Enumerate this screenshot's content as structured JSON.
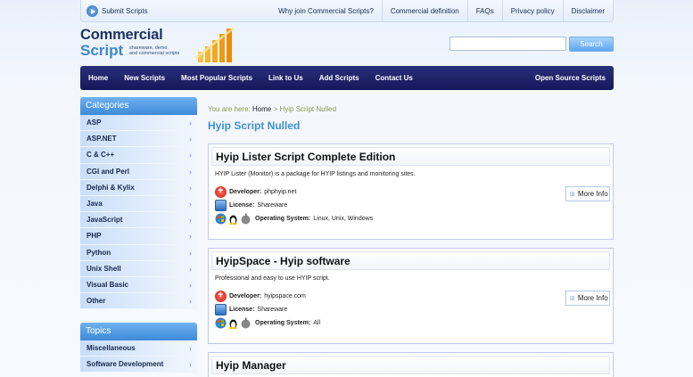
{
  "topbar": {
    "submit_label": "Submit Scripts",
    "links": [
      "Why join Commercial Scripts?",
      "Commercial definition",
      "FAQs",
      "Privacy policy",
      "Disclaimer"
    ]
  },
  "logo": {
    "line1": "Commercial",
    "line2": "Script",
    "tagline_1": "shareware, demo",
    "tagline_2": "and commercial scripts"
  },
  "search": {
    "value": "",
    "button_label": "Search"
  },
  "nav": {
    "items": [
      "Home",
      "New Scripts",
      "Most Popular Scripts",
      "Link to Us",
      "Add Scripts",
      "Contact Us"
    ],
    "right_item": "Open Source Scripts"
  },
  "sidebar": {
    "categories_title": "Categories",
    "categories": [
      "ASP",
      "ASP.NET",
      "C & C++",
      "CGI and Perl",
      "Delphi & Kylix",
      "Java",
      "JavaScript",
      "PHP",
      "Python",
      "Unix Shell",
      "Visual Basic",
      "Other"
    ],
    "topics_title": "Topics",
    "topics": [
      "Miscellaneous",
      "Software Development"
    ]
  },
  "breadcrumb": {
    "prefix": "You are here:",
    "home": "Home",
    "separator": ">",
    "current": "Hyip Script Nulled"
  },
  "page_title": "Hyip Script Nulled",
  "results": [
    {
      "title": "Hyip Lister Script Complete Edition",
      "description": "HYIP Lister (Monitor) is a package for HYIP listings and monitoring sites.",
      "developer_label": "Developer:",
      "developer": "phphyip.net",
      "license_label": "License:",
      "license": "Shareware",
      "os_label": "Operating System:",
      "os": "Linux, Unix, Windows",
      "more_label": "More Info"
    },
    {
      "title": "HyipSpace - Hyip software",
      "description": "Professional and easy to use HYIP script.",
      "developer_label": "Developer:",
      "developer": "hyipspace.com",
      "license_label": "License:",
      "license": "Shareware",
      "os_label": "Operating System:",
      "os": "All",
      "more_label": "More Info"
    },
    {
      "title": "Hyip Manager"
    }
  ],
  "colors": {
    "nav_bg": "#1c2068",
    "accent_blue": "#3e8fd8",
    "sidebar_head": "#5aa0e6"
  },
  "icons": {
    "submit": "play-circle-icon",
    "developer": "red-plus-icon",
    "license": "license-icon",
    "os": [
      "windows-icon",
      "linux-tux-icon",
      "apple-icon"
    ],
    "more": "expand-icon"
  }
}
